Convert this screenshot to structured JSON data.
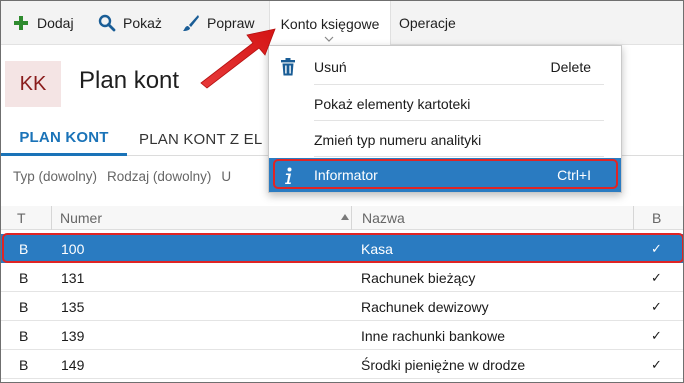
{
  "toolbar": {
    "add_label": "Dodaj",
    "show_label": "Pokaż",
    "edit_label": "Popraw",
    "account_label": "Konto księgowe",
    "operations_label": "Operacje"
  },
  "header": {
    "badge": "KK",
    "title": "Plan kont"
  },
  "tabs": [
    {
      "label": "PLAN KONT"
    },
    {
      "label": "PLAN KONT Z EL"
    }
  ],
  "filters": [
    {
      "label": "Typ (dowolny)"
    },
    {
      "label": "Rodzaj (dowolny)"
    },
    {
      "label": "U"
    }
  ],
  "grid": {
    "columns": [
      "T",
      "Numer",
      "Nazwa",
      "B"
    ],
    "rows": [
      {
        "t": "B",
        "num": "100",
        "nazwa": "Kasa",
        "b": "✓"
      },
      {
        "t": "B",
        "num": "131",
        "nazwa": "Rachunek bieżący",
        "b": "✓"
      },
      {
        "t": "B",
        "num": "135",
        "nazwa": "Rachunek dewizowy",
        "b": "✓"
      },
      {
        "t": "B",
        "num": "139",
        "nazwa": "Inne rachunki bankowe",
        "b": "✓"
      },
      {
        "t": "B",
        "num": "149",
        "nazwa": "Środki pieniężne w drodze",
        "b": "✓"
      }
    ]
  },
  "menu": {
    "items": [
      {
        "label": "Usuń",
        "shortcut": "Delete",
        "icon": "trash-icon"
      },
      {
        "label": "Pokaż elementy kartoteki",
        "shortcut": "",
        "icon": ""
      },
      {
        "label": "Zmień typ numeru analityki",
        "shortcut": "",
        "icon": ""
      },
      {
        "label": "Informator",
        "shortcut": "Ctrl+I",
        "icon": "info-icon"
      }
    ]
  },
  "colors": {
    "accent": "#2a7bc1",
    "highlight_outline": "#e02424",
    "add_icon": "#2e8b2e",
    "badge_bg": "#f4e4e4",
    "badge_text": "#8a1c1c"
  }
}
